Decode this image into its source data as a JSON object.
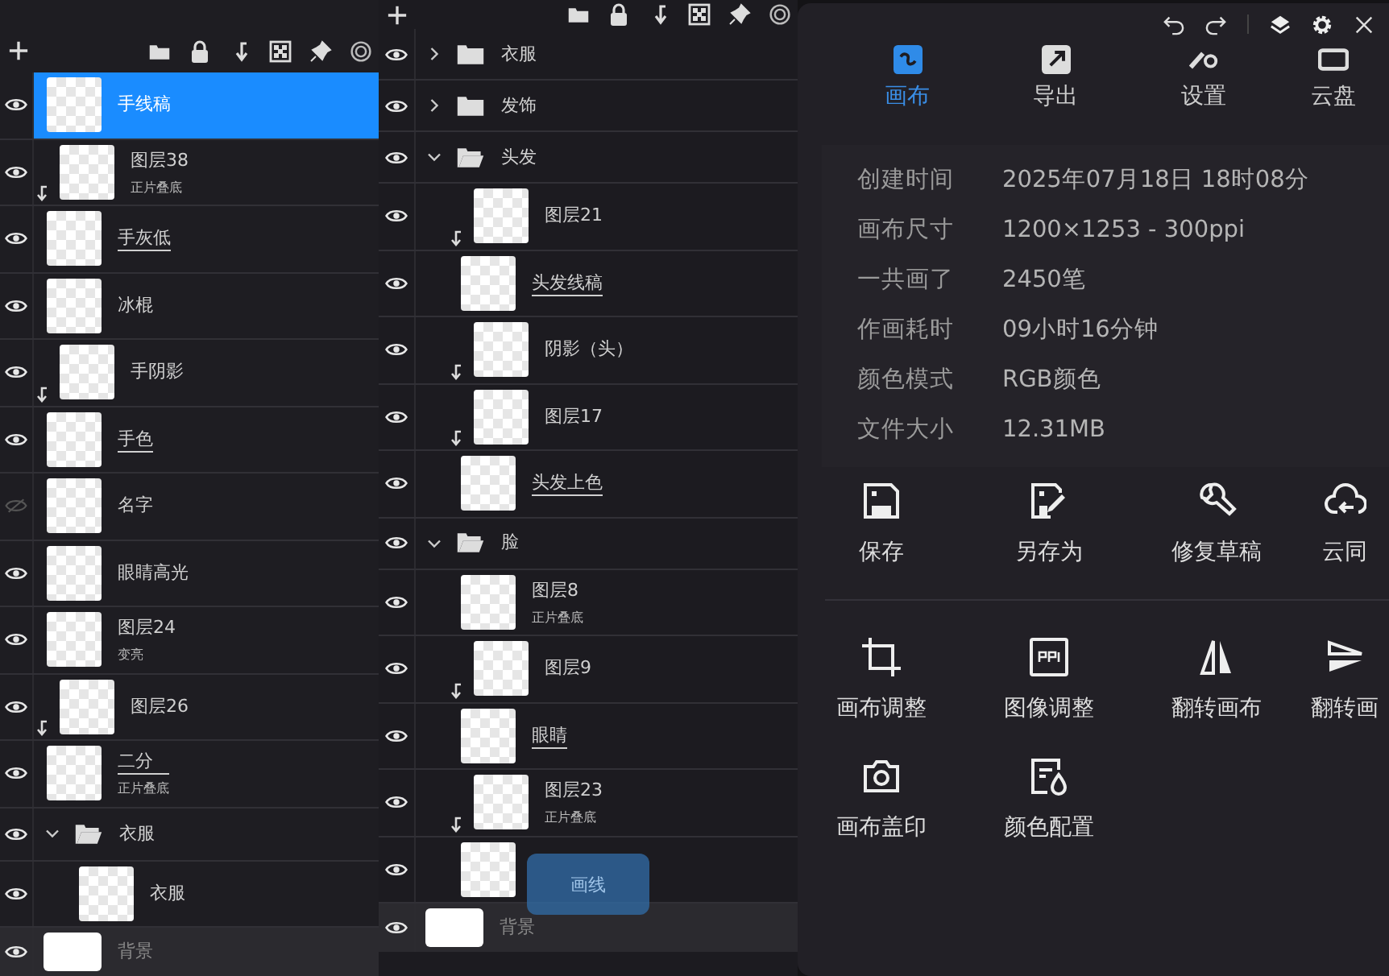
{
  "left": {
    "layers": [
      {
        "kind": "layer",
        "name": "手线稿",
        "visible": true,
        "selected": true,
        "clipped": false,
        "reference": false
      },
      {
        "kind": "layer",
        "name": "图层38",
        "mode": "正片叠底",
        "visible": true,
        "selected": false,
        "clipped": true,
        "reference": false
      },
      {
        "kind": "layer",
        "name": "手灰低",
        "visible": true,
        "selected": false,
        "clipped": false,
        "reference": true
      },
      {
        "kind": "layer",
        "name": "冰棍",
        "visible": true,
        "selected": false,
        "clipped": false,
        "reference": false
      },
      {
        "kind": "layer",
        "name": "手阴影",
        "visible": true,
        "selected": false,
        "clipped": true,
        "reference": false
      },
      {
        "kind": "layer",
        "name": "手色",
        "visible": true,
        "selected": false,
        "clipped": false,
        "reference": true
      },
      {
        "kind": "layer",
        "name": "名字",
        "visible": false,
        "selected": false,
        "clipped": false,
        "reference": false
      },
      {
        "kind": "layer",
        "name": "眼睛高光",
        "visible": true,
        "selected": false,
        "clipped": false,
        "reference": false
      },
      {
        "kind": "layer",
        "name": "图层24",
        "mode": "变亮",
        "visible": true,
        "selected": false,
        "clipped": false,
        "reference": false
      },
      {
        "kind": "layer",
        "name": "图层26",
        "visible": true,
        "selected": false,
        "clipped": true,
        "reference": false
      },
      {
        "kind": "layer",
        "name": "二分",
        "mode": "正片叠底",
        "visible": true,
        "selected": false,
        "clipped": false,
        "reference": true
      },
      {
        "kind": "folder",
        "name": "衣服",
        "visible": true,
        "expanded": true,
        "children": [
          {
            "kind": "layer",
            "name": "衣服",
            "visible": true,
            "selected": false,
            "clipped": false,
            "reference": false
          }
        ]
      }
    ],
    "background": {
      "name": "背景",
      "visible": true
    }
  },
  "middle": {
    "layers": [
      {
        "kind": "folder",
        "name": "衣服",
        "visible": true,
        "expanded": false
      },
      {
        "kind": "folder",
        "name": "发饰",
        "visible": true,
        "expanded": false
      },
      {
        "kind": "folder",
        "name": "头发",
        "visible": true,
        "expanded": true,
        "children": [
          {
            "kind": "layer",
            "name": "图层21",
            "visible": true,
            "selected": false,
            "clipped": true,
            "reference": false
          },
          {
            "kind": "layer",
            "name": "头发线稿",
            "visible": true,
            "selected": false,
            "clipped": false,
            "reference": true
          },
          {
            "kind": "layer",
            "name": "阴影（头）",
            "visible": true,
            "selected": false,
            "clipped": true,
            "reference": false
          },
          {
            "kind": "layer",
            "name": "图层17",
            "visible": true,
            "selected": false,
            "clipped": true,
            "reference": false
          },
          {
            "kind": "layer",
            "name": "头发上色",
            "visible": true,
            "selected": false,
            "clipped": false,
            "reference": true
          }
        ]
      },
      {
        "kind": "folder",
        "name": "脸",
        "visible": true,
        "expanded": true,
        "children": [
          {
            "kind": "layer",
            "name": "图层8",
            "mode": "正片叠底",
            "visible": true,
            "selected": false,
            "clipped": false,
            "reference": false
          },
          {
            "kind": "layer",
            "name": "图层9",
            "visible": true,
            "selected": false,
            "clipped": true,
            "reference": false
          },
          {
            "kind": "layer",
            "name": "眼睛",
            "visible": true,
            "selected": false,
            "clipped": false,
            "reference": true
          },
          {
            "kind": "layer",
            "name": "图层23",
            "mode": "正片叠底",
            "visible": true,
            "selected": false,
            "clipped": true,
            "reference": false
          },
          {
            "kind": "layer",
            "visible": true,
            "selected": false
          }
        ]
      }
    ],
    "background": {
      "name": "背景",
      "visible": true
    },
    "toast": {
      "text": "画线"
    }
  },
  "right": {
    "tabs": [
      {
        "label": "画布",
        "selected": true
      },
      {
        "label": "导出",
        "selected": false
      },
      {
        "label": "设置",
        "selected": false
      },
      {
        "label": "云盘",
        "selected": false
      }
    ],
    "info": [
      {
        "label": "创建时间",
        "value": "2025年07月18日 18时08分"
      },
      {
        "label": "画布尺寸",
        "value": "1200×1253 - 300ppi"
      },
      {
        "label": "一共画了",
        "value": "2450笔"
      },
      {
        "label": "作画耗时",
        "value": "09小时16分钟"
      },
      {
        "label": "颜色模式",
        "value": "RGB颜色"
      },
      {
        "label": "文件大小",
        "value": "12.31MB"
      }
    ],
    "action_groups": [
      {
        "items": [
          "保存",
          "另存为",
          "修复草稿",
          "云同"
        ]
      },
      {
        "items": [
          "画布调整",
          "图像调整",
          "翻转画布",
          "翻转画",
          "画布盖印",
          "颜色配置"
        ]
      }
    ]
  }
}
